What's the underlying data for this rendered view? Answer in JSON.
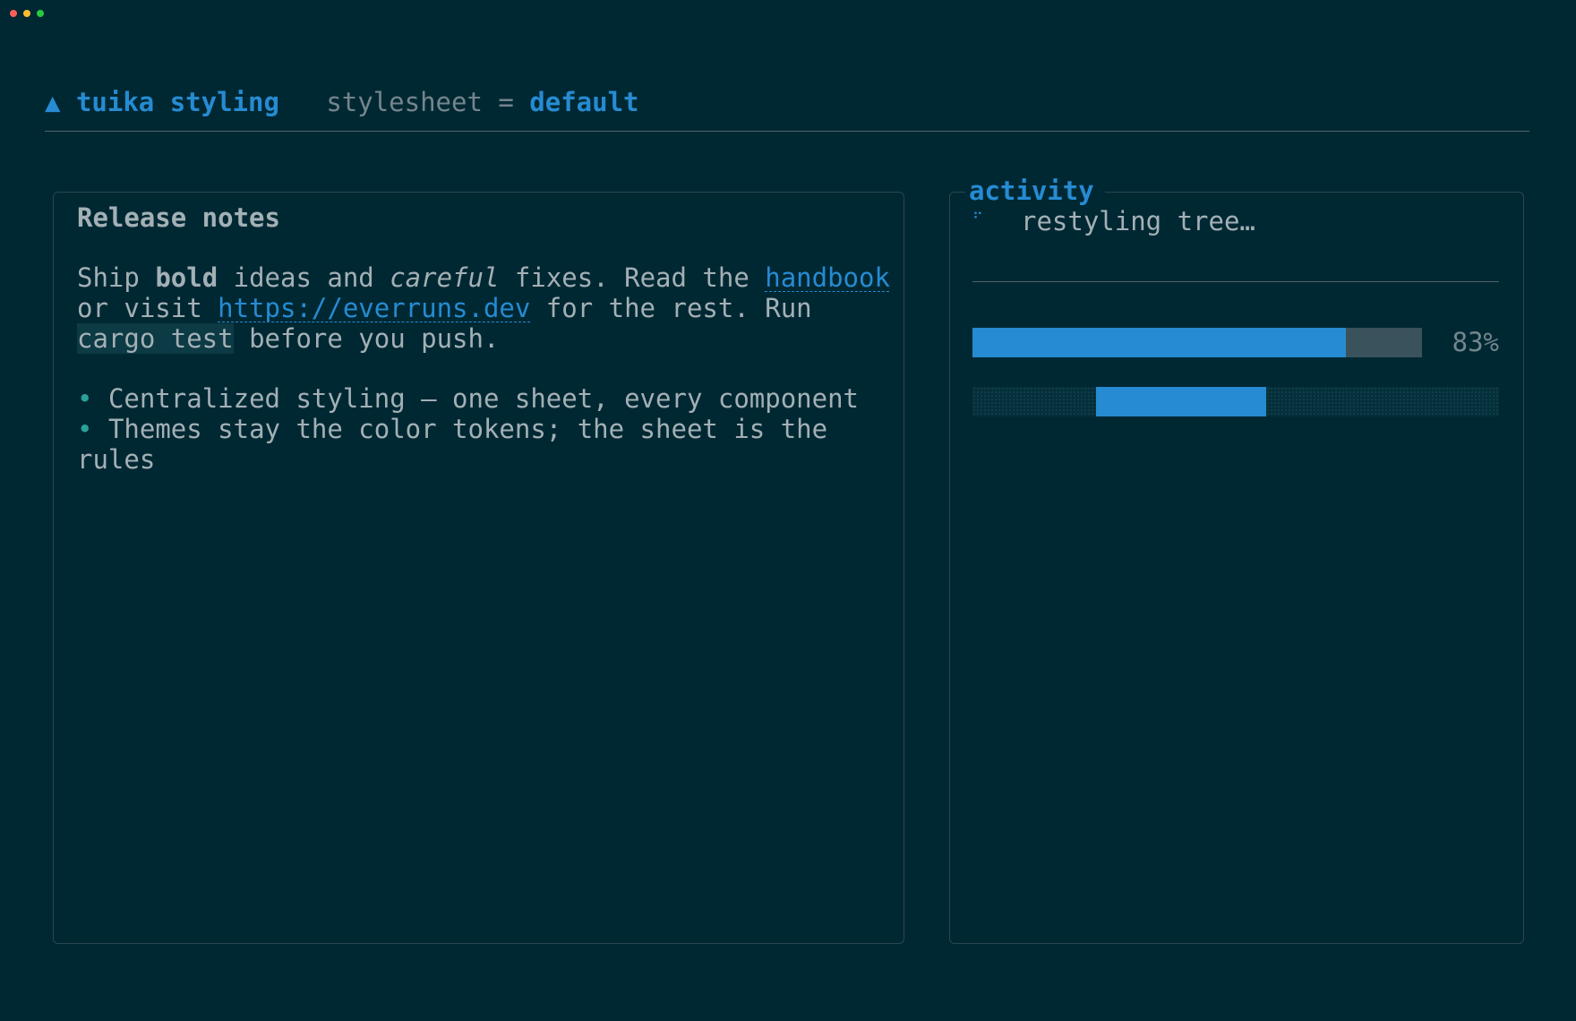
{
  "window": {
    "controls": [
      "close",
      "minimize",
      "zoom"
    ]
  },
  "header": {
    "icon": "▲",
    "app_title": "tuika styling",
    "stylesheet_label": "stylesheet =",
    "stylesheet_value": "default"
  },
  "release_notes": {
    "title": "Release notes",
    "paragraph": {
      "l1_a": "Ship ",
      "l1_bold": "bold",
      "l1_b": " ideas and ",
      "l1_italic": "careful",
      "l1_c": " fixes. Read the ",
      "l1_link": "handbook",
      "l2_a": "or visit ",
      "l2_link": "https://everruns.dev",
      "l2_b": " for the rest. Run",
      "l3_code": "cargo test",
      "l3_a": " before you push."
    },
    "bullets": {
      "symbol": "•",
      "item1": "Centralized styling — one sheet, every component",
      "item2_l1": "Themes stay the color tokens; the sheet is the",
      "item2_l2": "rules"
    }
  },
  "activity": {
    "title": "activity",
    "spinner": "⠋",
    "status": "restyling tree…",
    "progress": {
      "percent_label": "83%",
      "fraction": 0.83
    },
    "indeterminate_bar": {
      "segment_start_fraction": 0.235,
      "segment_end_fraction": 0.558
    }
  },
  "colors": {
    "background": "#002833",
    "accent": "#268bd2",
    "bullet": "#2aa198",
    "text": "#a3b0b5",
    "muted": "#74858c"
  }
}
